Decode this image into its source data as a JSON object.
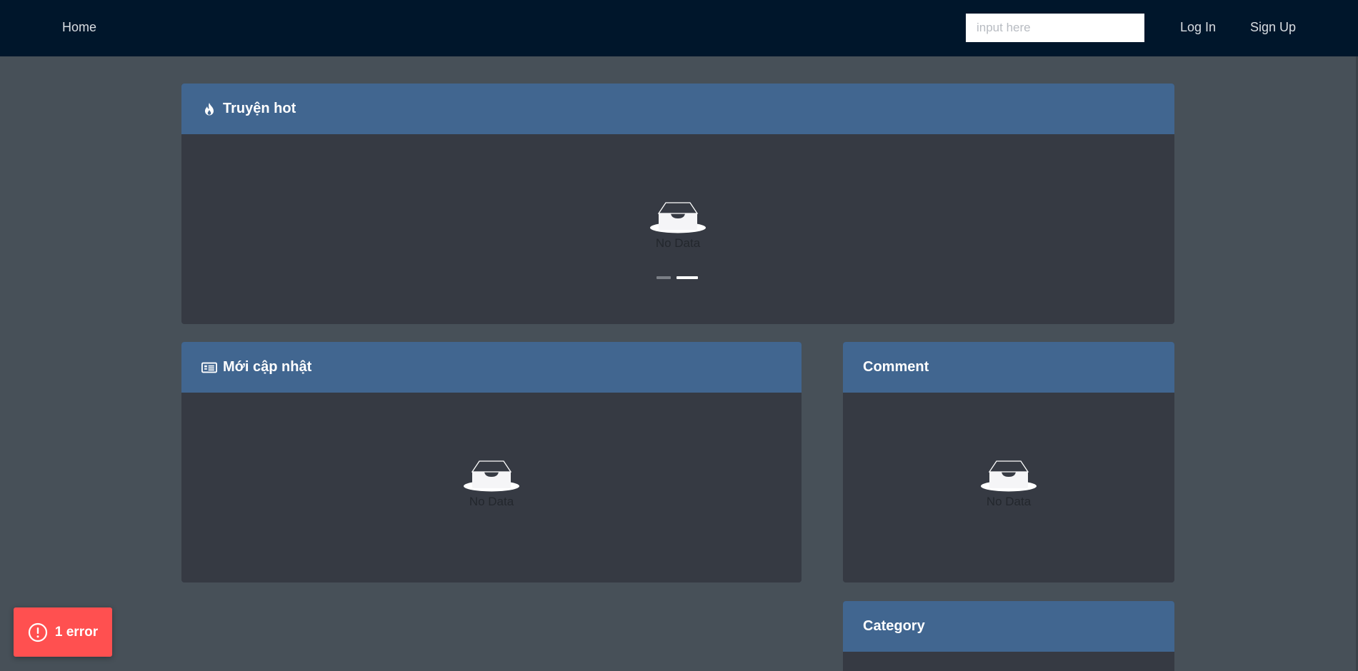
{
  "nav": {
    "home_label": "Home",
    "search_placeholder": "input here",
    "login_label": "Log In",
    "signup_label": "Sign Up"
  },
  "sections": {
    "hot": {
      "title": "Truyện hot",
      "empty_text": "No Data",
      "icon": "fire-icon"
    },
    "updated": {
      "title": "Mới cập nhật",
      "empty_text": "No Data",
      "icon": "newspaper-icon"
    },
    "comment": {
      "title": "Comment",
      "empty_text": "No Data"
    },
    "category": {
      "title": "Category"
    }
  },
  "carousel": {
    "slide_count": 2,
    "active_index": 1
  },
  "error_badge": {
    "label": "1 error",
    "icon": "exclamation-circle-icon"
  },
  "colors": {
    "topbar": "#00162b",
    "background": "#475058",
    "card_header": "#416690",
    "card_body": "#363a43",
    "error": "#ff5050"
  }
}
